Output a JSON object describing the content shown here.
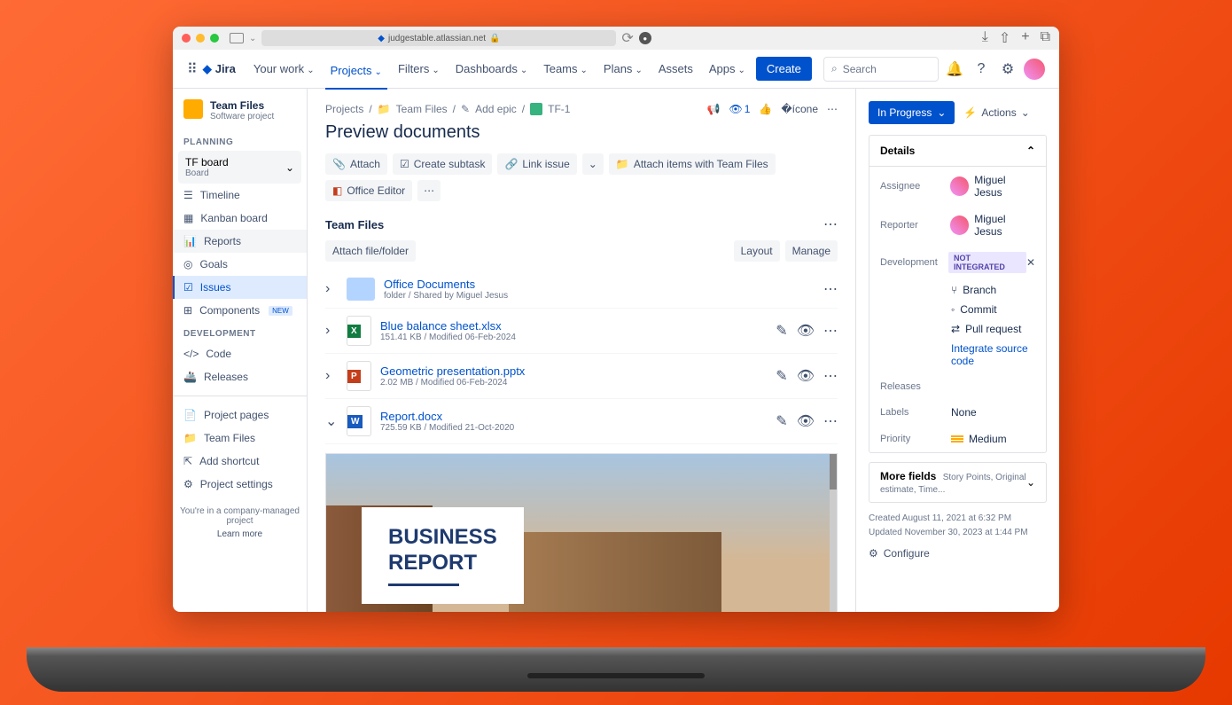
{
  "browser": {
    "url": "judgestable.atlassian.net"
  },
  "nav": {
    "product": "Jira",
    "yourwork": "Your work",
    "projects": "Projects",
    "filters": "Filters",
    "dashboards": "Dashboards",
    "teams": "Teams",
    "plans": "Plans",
    "assets": "Assets",
    "apps": "Apps",
    "create": "Create",
    "search_placeholder": "Search"
  },
  "project": {
    "name": "Team Files",
    "type": "Software project",
    "planning_label": "PLANNING",
    "board_name": "TF board",
    "board_sub": "Board",
    "timeline": "Timeline",
    "kanban": "Kanban board",
    "reports": "Reports",
    "goals": "Goals",
    "issues": "Issues",
    "components": "Components",
    "new": "NEW",
    "development_label": "DEVELOPMENT",
    "code": "Code",
    "releases": "Releases",
    "project_pages": "Project pages",
    "teamfiles": "Team Files",
    "add_shortcut": "Add shortcut",
    "project_settings": "Project settings",
    "company_managed": "You're in a company-managed project",
    "learn_more": "Learn more"
  },
  "breadcrumb": {
    "projects": "Projects",
    "teamfiles": "Team Files",
    "addepic": "Add epic",
    "issueid": "TF-1",
    "watch_count": "1"
  },
  "page": {
    "title": "Preview documents"
  },
  "actions": {
    "attach": "Attach",
    "subtask": "Create subtask",
    "link": "Link issue",
    "attach_tf": "Attach items with Team Files",
    "office": "Office Editor"
  },
  "teamfiles_section": {
    "title": "Team Files",
    "attach": "Attach file/folder",
    "layout": "Layout",
    "manage": "Manage"
  },
  "files": [
    {
      "name": "Office Documents",
      "meta": "folder / Shared by Miguel Jesus",
      "type": "folder"
    },
    {
      "name": "Blue balance sheet.xlsx",
      "meta": "151.41 KB / Modified 06-Feb-2024",
      "type": "xlsx"
    },
    {
      "name": "Geometric presentation.pptx",
      "meta": "2.02 MB / Modified 06-Feb-2024",
      "type": "pptx"
    },
    {
      "name": "Report.docx",
      "meta": "725.59 KB / Modified 21-Oct-2020",
      "type": "docx"
    }
  ],
  "preview": {
    "title1": "BUSINESS",
    "title2": "REPORT"
  },
  "details": {
    "status": "In Progress",
    "actions": "Actions",
    "header": "Details",
    "assignee_label": "Assignee",
    "assignee": "Miguel Jesus",
    "reporter_label": "Reporter",
    "reporter": "Miguel Jesus",
    "development_label": "Development",
    "not_integrated": "NOT INTEGRATED",
    "branch": "Branch",
    "commit": "Commit",
    "pullrequest": "Pull request",
    "integrate": "Integrate source code",
    "releases_label": "Releases",
    "labels_label": "Labels",
    "labels_value": "None",
    "priority_label": "Priority",
    "priority_value": "Medium",
    "more_fields": "More fields",
    "more_fields_sub": "Story Points, Original estimate, Time...",
    "created": "Created August 11, 2021 at 6:32 PM",
    "updated": "Updated November 30, 2023 at 1:44 PM",
    "configure": "Configure"
  }
}
